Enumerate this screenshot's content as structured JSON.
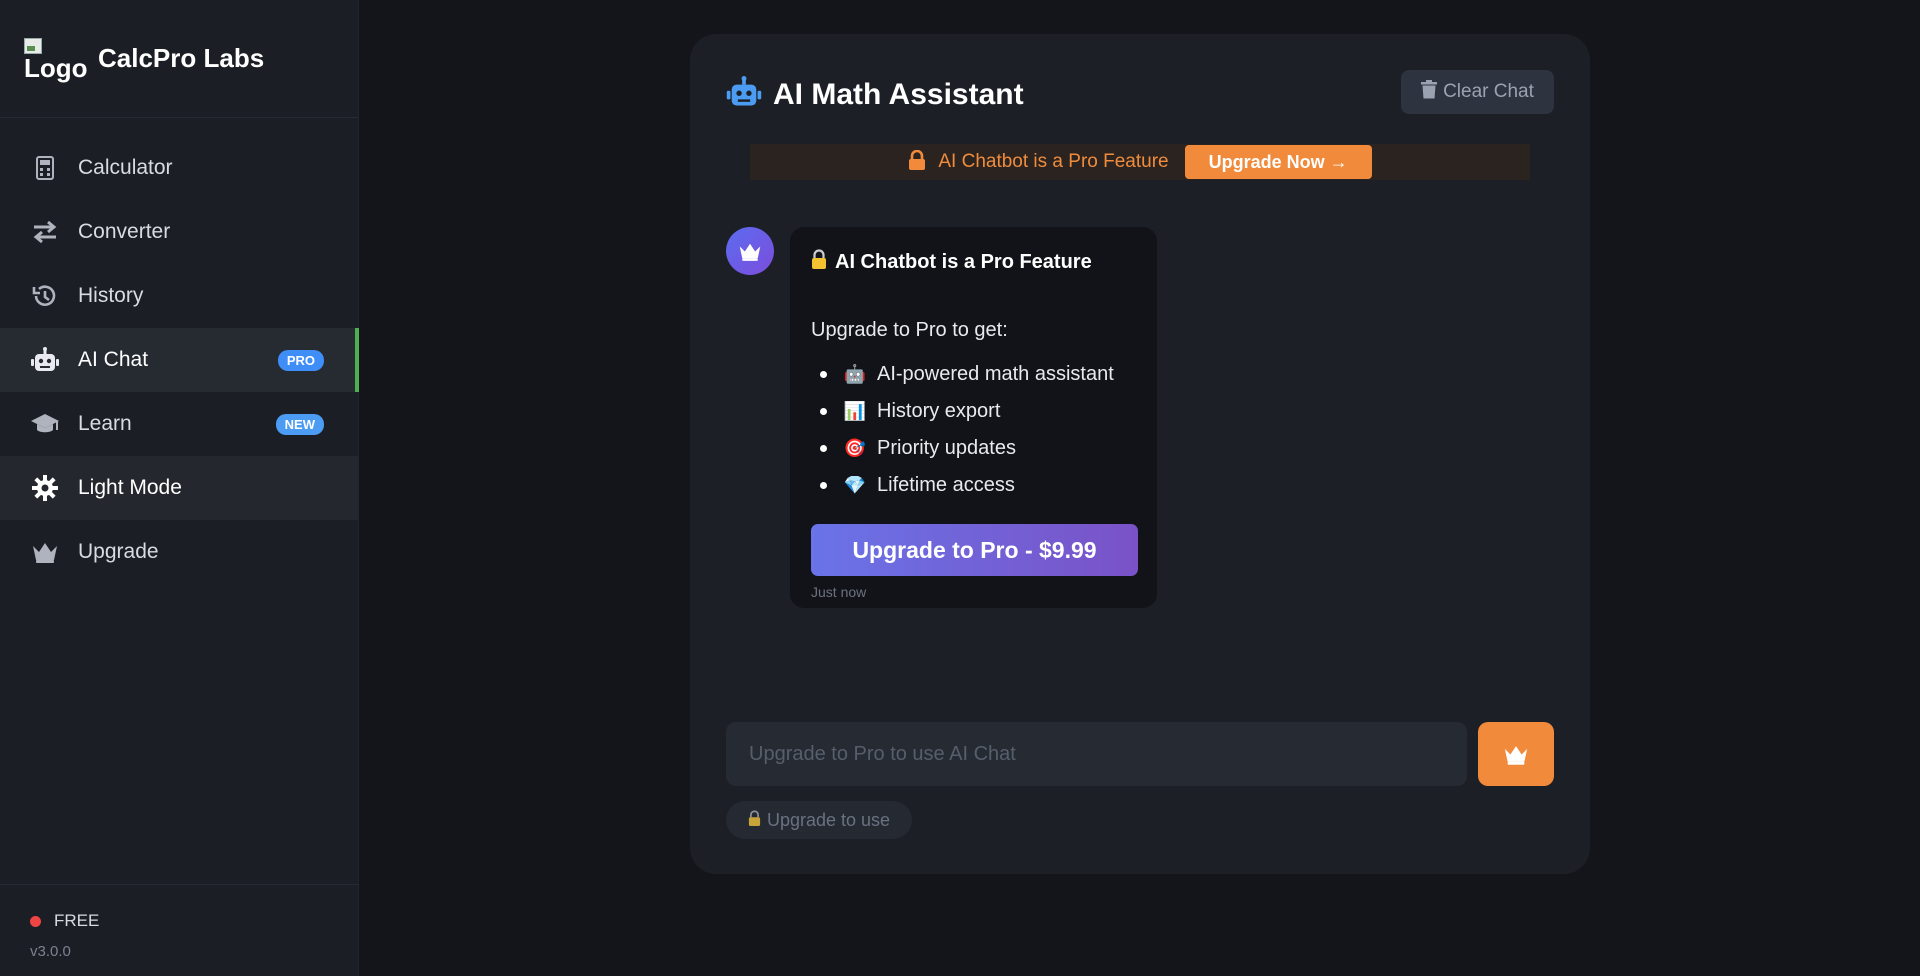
{
  "sidebar": {
    "brand": {
      "logo_alt": "Logo",
      "name": "CalcPro Labs"
    },
    "items": [
      {
        "label": "Calculator",
        "icon": "calculator-icon"
      },
      {
        "label": "Converter",
        "icon": "arrows-swap-icon"
      },
      {
        "label": "History",
        "icon": "history-icon"
      },
      {
        "label": "AI Chat",
        "icon": "robot-icon",
        "badge": "PRO"
      },
      {
        "label": "Learn",
        "icon": "graduation-cap-icon",
        "badge": "NEW"
      },
      {
        "label": "Light Mode",
        "icon": "gear-icon"
      },
      {
        "label": "Upgrade",
        "icon": "crown-icon"
      }
    ],
    "footer": {
      "plan": "FREE",
      "version": "v3.0.0"
    }
  },
  "chat": {
    "title": "AI Math Assistant",
    "clear_label": "Clear Chat",
    "banner": {
      "text": "AI Chatbot is a Pro Feature",
      "button": "Upgrade Now →"
    },
    "message": {
      "title": "AI Chatbot is a Pro Feature",
      "intro": "Upgrade to Pro to get:",
      "features": [
        {
          "emoji": "🤖",
          "text": "AI-powered math assistant"
        },
        {
          "emoji": "📊",
          "text": "History export"
        },
        {
          "emoji": "🎯",
          "text": "Priority updates"
        },
        {
          "emoji": "💎",
          "text": "Lifetime access"
        }
      ],
      "cta": "Upgrade to Pro - $9.99",
      "timestamp": "Just now"
    },
    "input": {
      "placeholder": "Upgrade to Pro to use AI Chat",
      "value": ""
    },
    "hint": "Upgrade to use"
  },
  "colors": {
    "accent_orange": "#f18a3a",
    "active_indicator": "#4caf50",
    "badge_blue": "#3f8ef7",
    "status_free": "#ef4444",
    "cta_gradient_start": "#6a73e8",
    "cta_gradient_end": "#7a52c7"
  }
}
